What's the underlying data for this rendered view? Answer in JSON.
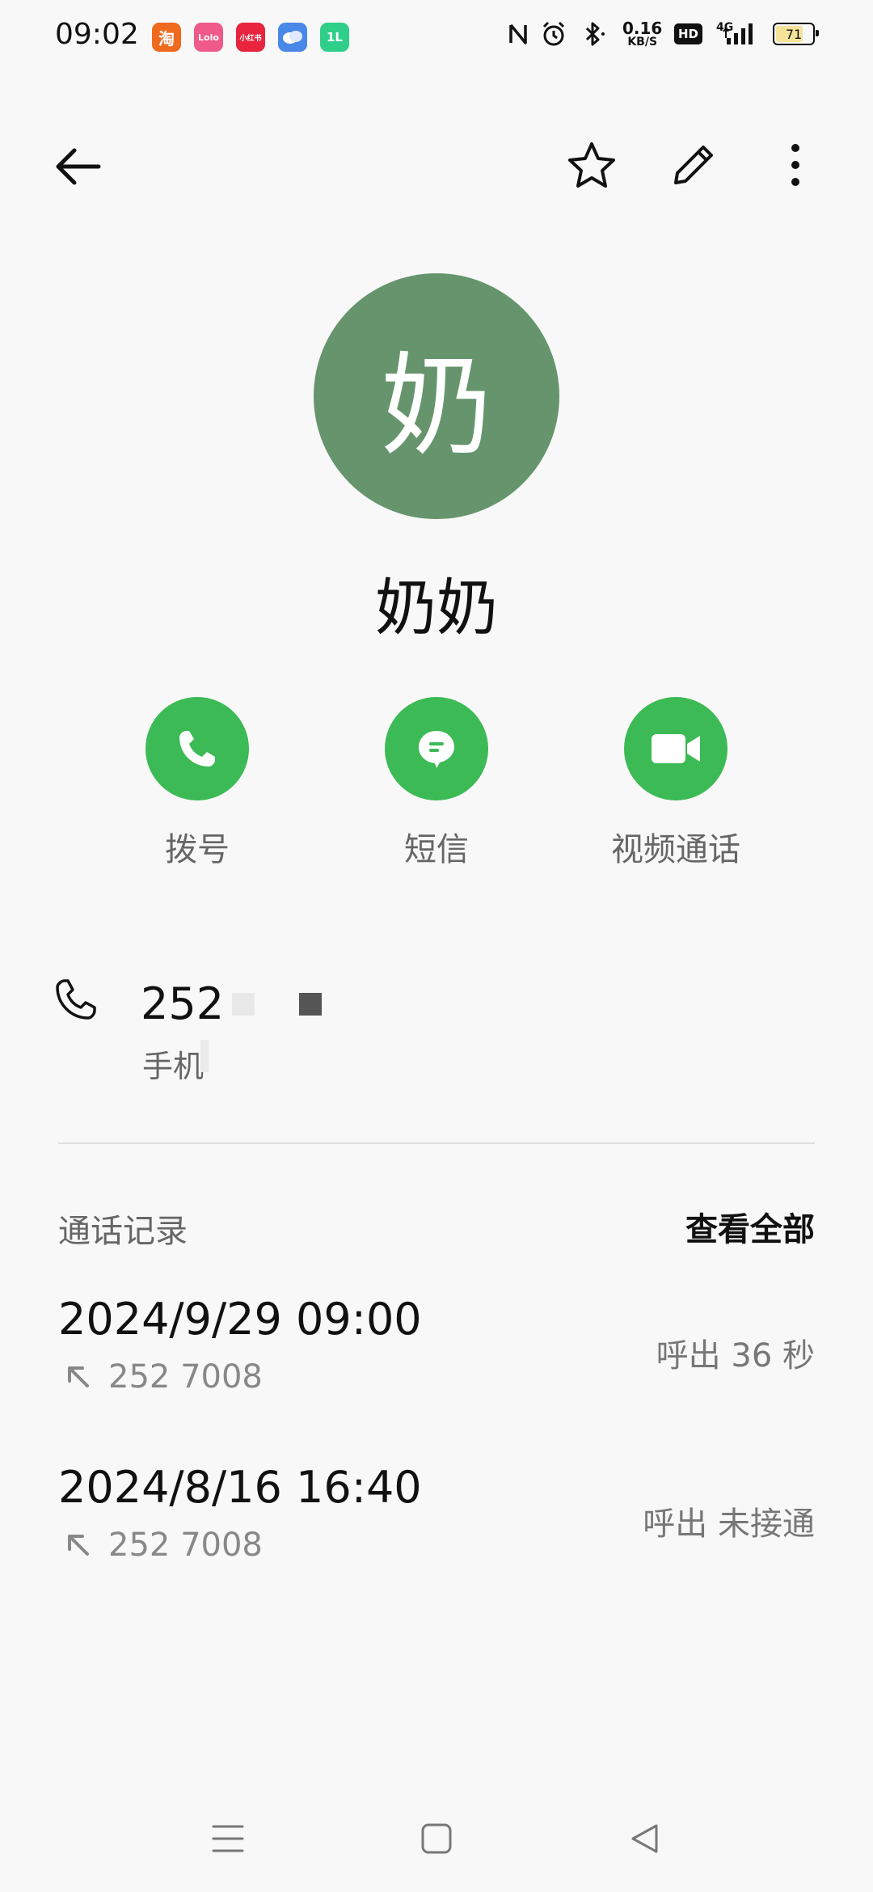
{
  "status_bar": {
    "time": "09:02",
    "app_icons": [
      {
        "name": "taobao-icon",
        "label": "淘",
        "color": "#ef6a1e"
      },
      {
        "name": "lofter-icon",
        "label": "Lolo",
        "color": "#ef5a8a"
      },
      {
        "name": "xiaohongshu-icon",
        "label": "小红书",
        "color": "#e8243e"
      },
      {
        "name": "weibo-icon",
        "label": "",
        "color": "#4a88e8"
      },
      {
        "name": "app-green-icon",
        "label": "1L",
        "color": "#2fcf8a"
      }
    ],
    "network_speed_value": "0.16",
    "network_speed_unit": "KB/S",
    "hd_label": "HD",
    "network_type": "4G",
    "battery_level": "71"
  },
  "toolbar": {
    "back_icon": "back-arrow-icon",
    "favorite_icon": "star-icon",
    "edit_icon": "pencil-icon",
    "more_icon": "more-vertical-icon"
  },
  "contact": {
    "avatar_char": "奶",
    "avatar_color": "#66956d",
    "name": "奶奶"
  },
  "actions": [
    {
      "label": "拨号",
      "icon": "phone-icon"
    },
    {
      "label": "短信",
      "icon": "message-icon"
    },
    {
      "label": "视频通话",
      "icon": "video-camera-icon"
    }
  ],
  "action_color": "#3cba55",
  "phone": {
    "number": "252",
    "type": "手机"
  },
  "call_log": {
    "title": "通话记录",
    "view_all": "查看全部",
    "entries": [
      {
        "datetime": "2024/9/29 09:00",
        "number": "252 7008",
        "status": "呼出  36 秒",
        "direction": "outgoing"
      },
      {
        "datetime": "2024/8/16 16:40",
        "number": "252 7008",
        "status": "呼出 未接通",
        "direction": "outgoing"
      }
    ]
  },
  "nav_bar": {
    "menu_icon": "menu-icon",
    "home_icon": "home-square-icon",
    "back_icon": "back-triangle-icon"
  }
}
